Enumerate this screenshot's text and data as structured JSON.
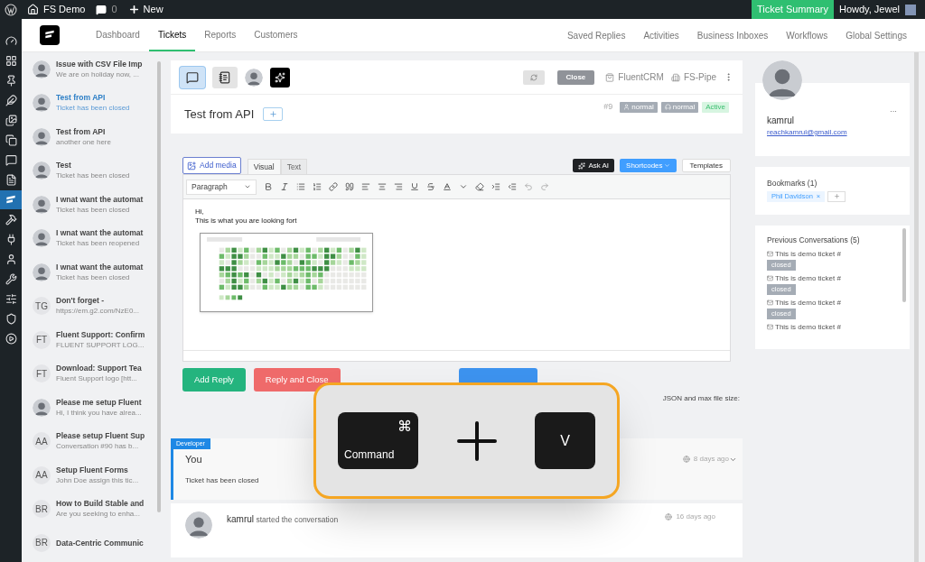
{
  "admin_bar": {
    "site": "FS Demo",
    "comments": "0",
    "new": "New",
    "summary": "Ticket Summary",
    "howdy": "Howdy, Jewel"
  },
  "wp_menu": [
    {
      "kind": "gauge",
      "selected": false
    },
    {
      "kind": "grid",
      "selected": false
    },
    {
      "kind": "pin",
      "selected": false
    },
    {
      "kind": "feather",
      "selected": false
    },
    {
      "kind": "media",
      "selected": false
    },
    {
      "kind": "pages",
      "selected": false
    },
    {
      "kind": "comment",
      "selected": false
    },
    {
      "kind": "form",
      "selected": false
    },
    {
      "kind": "fluent",
      "selected": true
    },
    {
      "kind": "hammer",
      "selected": false
    },
    {
      "kind": "plug",
      "selected": false
    },
    {
      "kind": "user",
      "selected": false
    },
    {
      "kind": "wrench",
      "selected": false
    },
    {
      "kind": "sliders",
      "selected": false
    },
    {
      "kind": "shield",
      "selected": false
    },
    {
      "kind": "play",
      "selected": false
    }
  ],
  "nav": {
    "main": [
      {
        "label": "Dashboard",
        "selected": false
      },
      {
        "label": "Tickets",
        "selected": true
      },
      {
        "label": "Reports",
        "selected": false
      },
      {
        "label": "Customers",
        "selected": false
      }
    ],
    "secondary": [
      "Saved Replies",
      "Activities",
      "Business Inboxes",
      "Workflows",
      "Global Settings"
    ]
  },
  "tickets": [
    {
      "title": "Issue with CSV File Imp",
      "snippet": "We are on holiday now, ...",
      "kind": "photo",
      "selected": false
    },
    {
      "title": "Test from API",
      "snippet": "Ticket has been closed",
      "kind": "photo",
      "selected": true
    },
    {
      "title": "Test from API",
      "snippet": "another one here",
      "kind": "photo",
      "selected": false
    },
    {
      "title": "Test",
      "snippet": "Ticket has been closed",
      "kind": "photo",
      "selected": false
    },
    {
      "title": "I wnat want the automat",
      "snippet": "Ticket has been closed",
      "kind": "photo",
      "selected": false
    },
    {
      "title": "I wnat want the automat",
      "snippet": "Ticket has been reopened",
      "kind": "photo",
      "selected": false
    },
    {
      "title": "I wnat want the automat",
      "snippet": "Ticket has been closed",
      "kind": "photo",
      "selected": false
    },
    {
      "title": "Don't forget -",
      "snippet": "https://em.g2.com/NzE0...",
      "kind": "initials",
      "initials": "TG",
      "selected": false
    },
    {
      "title": "Fluent Support: Confirm",
      "snippet": "FLUENT SUPPORT LOG...",
      "kind": "initials",
      "initials": "FT",
      "selected": false
    },
    {
      "title": "Download: Support Tea",
      "snippet": "Fluent Support logo [htt...",
      "kind": "initials",
      "initials": "FT",
      "selected": false
    },
    {
      "title": "Please me setup Fluent",
      "snippet": "Hi, I think you have alrea...",
      "kind": "photo",
      "selected": false
    },
    {
      "title": "Please setup Fluent Sup",
      "snippet": "Conversation #90 has b...",
      "kind": "initials",
      "initials": "AA",
      "selected": false
    },
    {
      "title": "Setup Fluent Forms",
      "snippet": "John Doe assign this tic...",
      "kind": "initials",
      "initials": "AA",
      "selected": false
    },
    {
      "title": "How to Build Stable and",
      "snippet": "Are you seeking to enha...",
      "kind": "initials",
      "initials": "BR",
      "selected": false
    },
    {
      "title": "Data-Centric Communic",
      "kind": "initials",
      "initials": "BR",
      "selected": false
    }
  ],
  "ticket": {
    "tools": [
      {
        "kind": "chat",
        "selected": true
      },
      {
        "kind": "notebook",
        "selected": false
      },
      {
        "kind": "avatar"
      },
      {
        "kind": "ai"
      }
    ],
    "close": "Close",
    "crm": "FluentCRM",
    "pipe": "FS-Pipe",
    "title": "Test from API",
    "number": "#9",
    "badges": [
      {
        "kind": "person",
        "label": "normal"
      },
      {
        "kind": "agent",
        "label": "normal"
      },
      {
        "kind": "status",
        "label": "Active"
      }
    ]
  },
  "editor": {
    "add_media": "Add media",
    "tabs": [
      {
        "label": "Visual",
        "selected": true
      },
      {
        "label": "Text",
        "selected": false
      }
    ],
    "ask_ai": "Ask AI",
    "shortcodes": "Shortcodes",
    "templates": "Templates",
    "format": "Paragraph",
    "lines": [
      "Hi,",
      "This is what you are looking fort"
    ]
  },
  "actions": {
    "add_reply": "Add Reply",
    "reply_close": "Reply and Close",
    "note": "JSON and max file size:"
  },
  "activity": [
    {
      "badge": "Developer",
      "author": "You",
      "text": "Ticket has been closed",
      "time": "8 days ago"
    },
    {
      "author": "kamrul",
      "text": "started the conversation",
      "time": "16 days ago"
    }
  ],
  "shortcut": {
    "keys": [
      {
        "label": "Command",
        "symbol": "⌘"
      },
      {
        "label": "V"
      }
    ]
  },
  "customer": {
    "name": "kamrul",
    "email": "reachkamrul@gmail.com",
    "menu": "···"
  },
  "bookmarks": {
    "title": "Bookmarks (1)",
    "tags": [
      "Phil Davidson"
    ],
    "remove": "×"
  },
  "previous": {
    "title": "Previous Conversations (5)",
    "items": [
      {
        "title": "This is demo ticket #",
        "status": "closed"
      },
      {
        "title": "This is demo ticket #",
        "status": "closed"
      },
      {
        "title": "This is demo ticket #",
        "status": "closed"
      },
      {
        "title": "This is demo ticket #"
      }
    ]
  }
}
